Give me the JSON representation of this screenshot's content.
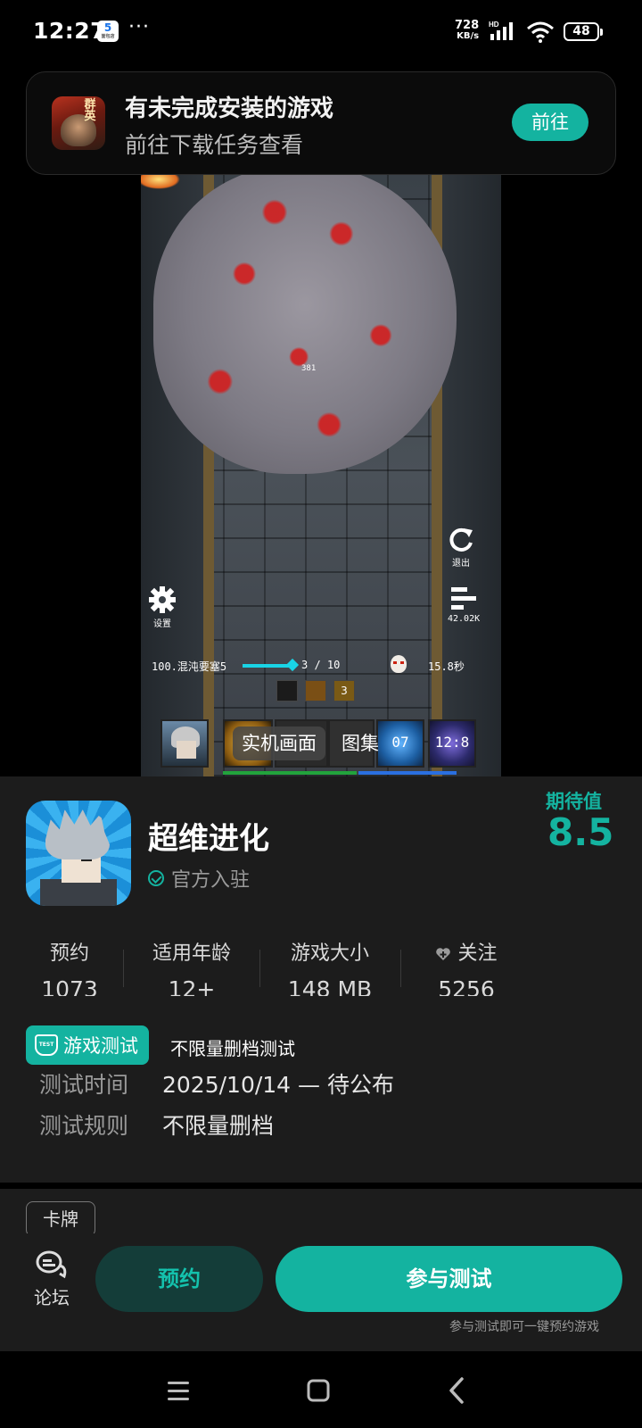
{
  "status_bar": {
    "time": "12:27",
    "app_badge": "5",
    "app_badge_sub": "面包店",
    "more": "···",
    "net_speed_value": "728",
    "net_speed_unit": "KB/s",
    "signal_label": "HD",
    "battery": "48"
  },
  "banner": {
    "icon_text": "群英",
    "title": "有未完成安装的游戏",
    "subtitle": "前往下载任务查看",
    "button": "前往"
  },
  "screenshot": {
    "damage_text": "381",
    "exit_label": "退出",
    "settings_label": "设置",
    "rank_label": "42.02K",
    "level_text": "100.混沌要塞5",
    "wave_text": "3 / 10",
    "timer_text": "15.8秒",
    "skill_count": "3",
    "card_numbers": [
      "07",
      "12:8"
    ],
    "tabs": [
      "实机画面",
      "图集"
    ],
    "active_tab": 0
  },
  "game": {
    "name": "超维进化",
    "official": "官方入驻",
    "expect_label": "期待值",
    "expect_value": "8.5",
    "stats": [
      {
        "label": "预约",
        "value": "1073"
      },
      {
        "label": "适用年龄",
        "value": "12+"
      },
      {
        "label": "游戏大小",
        "value": "148 MB"
      },
      {
        "label": "关注",
        "value": "5256"
      }
    ],
    "test_badge": "游戏测试",
    "test_badge_icon": "TEST",
    "test_type": "不限量删档测试",
    "test_time_label": "测试时间",
    "test_time_value": "2025/10/14 — 待公布",
    "test_rule_label": "测试规则",
    "test_rule_value": "不限量删档"
  },
  "section2": {
    "tag": "卡牌"
  },
  "actions": {
    "forum_label": "论坛",
    "reserve": "预约",
    "join": "参与测试",
    "join_hint": "参与测试即可一键预约游戏"
  },
  "colors": {
    "accent": "#14b3a0",
    "panel_bg": "#1c1c1c",
    "reserve_bg": "#143d39"
  }
}
